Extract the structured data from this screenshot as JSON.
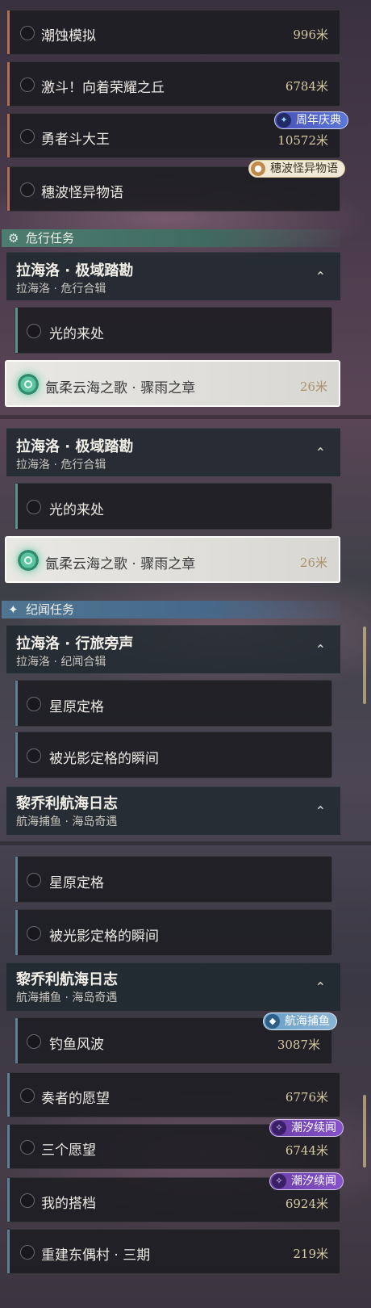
{
  "quests_top": [
    {
      "label": "潮蚀模拟",
      "dist": "996米"
    },
    {
      "label": "激斗！向着荣耀之丘",
      "dist": "6784米"
    },
    {
      "label": "勇者斗大王",
      "dist": "10572米",
      "badge": "周年庆典"
    },
    {
      "label": "穗波怪异物语",
      "dist": "",
      "badge": "穗波怪异物语"
    }
  ],
  "section_danger": {
    "label": "危行任务"
  },
  "group_danger": {
    "title": "拉海洛 · 极域踏勘",
    "sub": "拉海洛 · 危行合辑",
    "chevron": "⌃"
  },
  "danger_items": [
    {
      "label": "光的来处"
    },
    {
      "label": "氤柔云海之歌 · 骤雨之章",
      "dist": "26米"
    }
  ],
  "section_lore": {
    "label": "纪闻任务"
  },
  "group_lore": {
    "title": "拉海洛 · 行旅旁声",
    "sub": "拉海洛 · 纪闻合辑",
    "chevron": "⌃"
  },
  "lore_items": [
    {
      "label": "星原定格"
    },
    {
      "label": "被光影定格的瞬间"
    }
  ],
  "group_voyage": {
    "title": "黎乔利航海日志",
    "sub": "航海捕鱼 · 海岛奇遇",
    "chevron": "⌃"
  },
  "voyage_items": [
    {
      "label": "钓鱼风波",
      "dist": "3087米",
      "badge": "航海捕鱼"
    }
  ],
  "quests_bottom": [
    {
      "label": "奏者的愿望",
      "dist": "6776米"
    },
    {
      "label": "三个愿望",
      "dist": "6744米",
      "badge": "潮汐续闻"
    },
    {
      "label": "我的搭档",
      "dist": "6924米",
      "badge": "潮汐续闻"
    },
    {
      "label": "重建东偶村 · 三期",
      "dist": "219米"
    }
  ],
  "icons": {
    "section_danger": "gear-icon",
    "section_lore": "sparkle-icon",
    "tracker": "target-icon"
  }
}
